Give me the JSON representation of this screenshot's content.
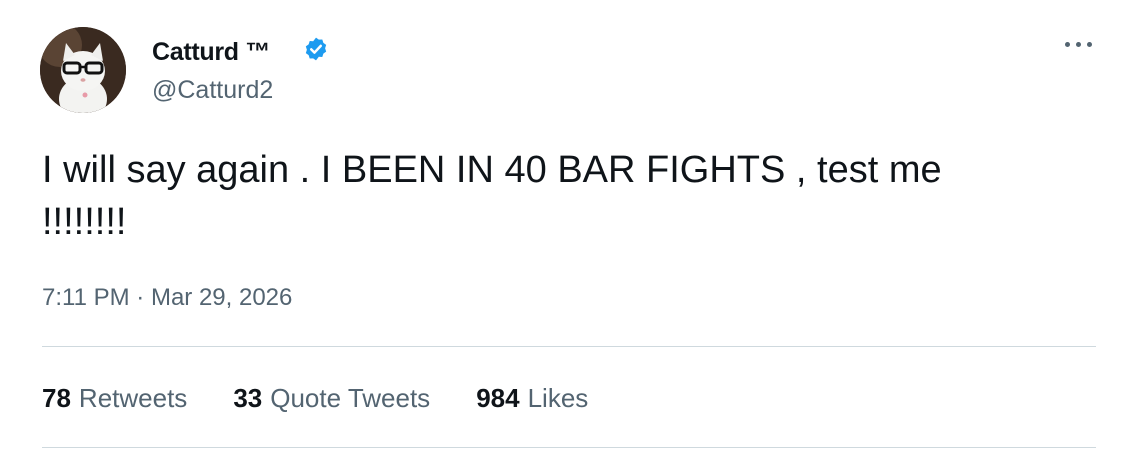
{
  "tweet": {
    "display_name": "Catturd ™",
    "handle": "@Catturd2",
    "verified_icon": "verified-badge-icon",
    "text": "I will say again . I BEEN IN 40 BAR FIGHTS , test me\n!!!!!!!!",
    "time": "7:11 PM",
    "dot": "·",
    "date": "Mar 29, 2026"
  },
  "stats": {
    "retweets_count": "78",
    "retweets_label": "Retweets",
    "quotes_count": "33",
    "quotes_label": "Quote Tweets",
    "likes_count": "984",
    "likes_label": "Likes"
  },
  "colors": {
    "verified": "#1d9bf0",
    "text": "#0f1419",
    "secondary": "#536471",
    "divider": "#cfd9de"
  }
}
